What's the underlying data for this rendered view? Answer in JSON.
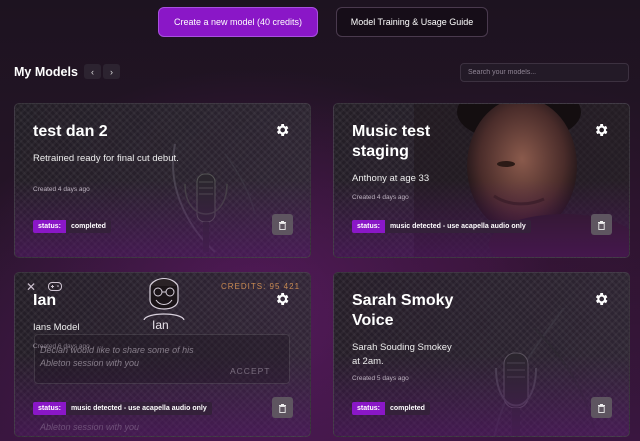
{
  "header": {
    "create_label": "Create a new model (40 credits)",
    "guide_label": "Model Training & Usage Guide"
  },
  "models_section": {
    "title": "My Models",
    "prev_icon": "chevron-left-icon",
    "next_icon": "chevron-right-icon",
    "prev_glyph": "‹",
    "next_glyph": "›",
    "search_placeholder": "Search your models..."
  },
  "cards": [
    {
      "title": "test dan 2",
      "description": "Retrained ready for final cut debut.",
      "created": "Created 4 days ago",
      "status_key": "status:",
      "status_value": "completed"
    },
    {
      "title": "Music test staging",
      "description": "Anthony at age 33",
      "created": "Created 4 days ago",
      "status_key": "status:",
      "status_value": "music detected - use acapella audio only"
    },
    {
      "title": "Ian",
      "description": "Ians Model",
      "created": "Created 6 days ago",
      "status_key": "status:",
      "status_value": "music detected - use acapella audio only"
    },
    {
      "title": "Sarah Smoky Voice",
      "description": "Sarah Souding Smokey at 2am.",
      "created": "Created 5 days ago",
      "status_key": "status:",
      "status_value": "completed"
    }
  ],
  "overlay": {
    "close_glyph": "✕",
    "credits_label": "CREDITS: 95 421",
    "user_name": "Ian",
    "message": "Declan would like to share some of his Ableton session with you",
    "accept_label": "ACCEPT",
    "message_repeat": "Ableton session with you"
  },
  "colors": {
    "accent": "#8a17c7",
    "background": "#1a0e1e",
    "credits": "#c98a52"
  }
}
